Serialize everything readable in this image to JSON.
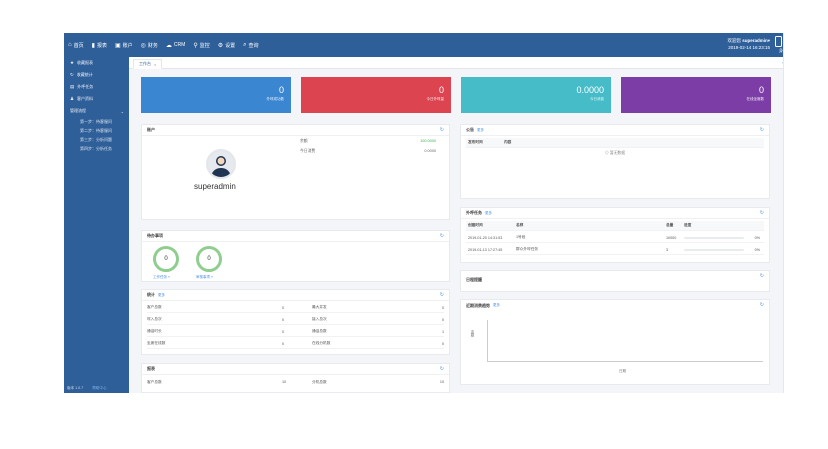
{
  "nav": [
    {
      "icon": "home-icon",
      "glyph": "⌂",
      "label": "首页"
    },
    {
      "icon": "chart-icon",
      "glyph": "▮",
      "label": "报表"
    },
    {
      "icon": "account-icon",
      "glyph": "▣",
      "label": "账户"
    },
    {
      "icon": "finance-icon",
      "glyph": "◎",
      "label": "财务"
    },
    {
      "icon": "crm-icon",
      "glyph": "☁",
      "label": "CRM"
    },
    {
      "icon": "monitor-icon",
      "glyph": "⚲",
      "label": "监控"
    },
    {
      "icon": "settings-icon",
      "glyph": "⚙",
      "label": "设置"
    },
    {
      "icon": "search-icon",
      "glyph": "⌕",
      "label": "查询"
    }
  ],
  "user": {
    "greeting": "欢迎您",
    "name": "superadmin",
    "datetime": "2019-02-14 16:23:15",
    "extra": "身"
  },
  "sidebar": {
    "items": [
      {
        "icon": "star-icon",
        "glyph": "★",
        "label": "收藏报表"
      },
      {
        "icon": "refresh-icon",
        "glyph": "↻",
        "label": "收藏统计"
      },
      {
        "icon": "list-icon",
        "glyph": "▤",
        "label": "外呼任务"
      },
      {
        "icon": "people-icon",
        "glyph": "♟",
        "label": "客户资料"
      }
    ],
    "group_label": "管理流程",
    "sub_items": [
      "第一步：待客服问",
      "第二步：待客服问",
      "第三步：分析问题",
      "第四步：分析任务"
    ],
    "footer_left": "版本 1.0.7",
    "footer_right": "帮助中心"
  },
  "tab": {
    "label": "工作台",
    "close": "×",
    "right": "»"
  },
  "stats": [
    {
      "value": "0",
      "label": "外呼成功数",
      "color": "#3a86d1"
    },
    {
      "value": "0",
      "label": "今日外呼量",
      "color": "#dc4450"
    },
    {
      "value": "0.0000",
      "label": "今日消费",
      "color": "#45bcc8"
    },
    {
      "value": "0",
      "label": "在线坐席数",
      "color": "#7c3ea6"
    }
  ],
  "account": {
    "title": "账户",
    "username": "superadmin",
    "rows": [
      {
        "k": "余额",
        "v": "100.0000"
      },
      {
        "k": "今日消费",
        "v": "0.0000"
      }
    ]
  },
  "pending": {
    "title": "待办事项",
    "circles": [
      {
        "value": "0",
        "label": "工作任务 »"
      },
      {
        "value": "0",
        "label": "审核事项 »"
      }
    ]
  },
  "notice": {
    "title": "公告",
    "more": "更多",
    "cols": [
      "发布时间",
      "内容"
    ],
    "empty": "暂无数据"
  },
  "call_tasks": {
    "title": "外呼任务",
    "more": "更多",
    "cols": [
      "创建时间",
      "名称",
      "总量",
      "进度"
    ],
    "rows": [
      {
        "time": "2019-01-20 14:31:53",
        "name": "1号段",
        "total": "10000",
        "progress": "0%"
      },
      {
        "time": "2019-01-13 17:27:45",
        "name": "群众外呼任务",
        "total": "3",
        "progress": "0%"
      }
    ]
  },
  "schedule": {
    "title": "日程提醒"
  },
  "summary": {
    "title": "统计",
    "more": "更多",
    "rows": [
      {
        "a": "客户总数",
        "av": "0",
        "b": "最大并发",
        "bv": "0"
      },
      {
        "a": "呼入总次",
        "av": "0",
        "b": "接入总次",
        "bv": "0"
      },
      {
        "a": "通话时长",
        "av": "0",
        "b": "通话总数",
        "bv": "1"
      },
      {
        "a": "坐席在线数",
        "av": "0",
        "b": "在线分机数",
        "bv": "0"
      }
    ]
  },
  "trend": {
    "title": "近期消费趋势",
    "more": "更多",
    "ylabel": "金额",
    "xlabel": "日期"
  },
  "report": {
    "title": "报表",
    "rows": [
      {
        "a": "客户总数",
        "av": "10",
        "b": "分机总数",
        "bv": "10"
      }
    ]
  }
}
